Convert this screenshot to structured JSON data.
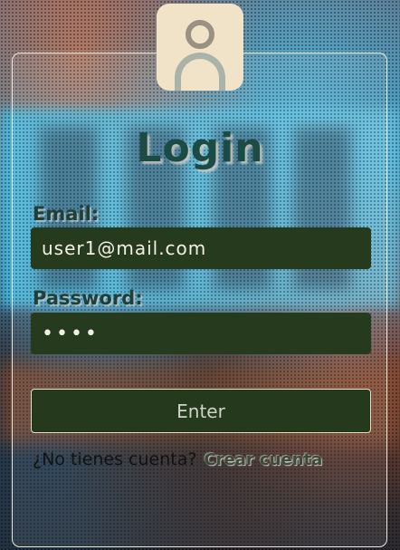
{
  "login": {
    "title": "Login",
    "email_label": "Email:",
    "email_value": "user1@mail.com",
    "password_label": "Password:",
    "password_value": "••••",
    "enter_label": "Enter",
    "signup_prompt": "¿No tienes cuenta?",
    "signup_link": "Crear cuenta"
  },
  "icons": {
    "avatar": "user-avatar-icon"
  },
  "colors": {
    "input_background": "#263b1d",
    "title_color": "#1c4a44",
    "avatar_background": "#f1e3c8"
  }
}
